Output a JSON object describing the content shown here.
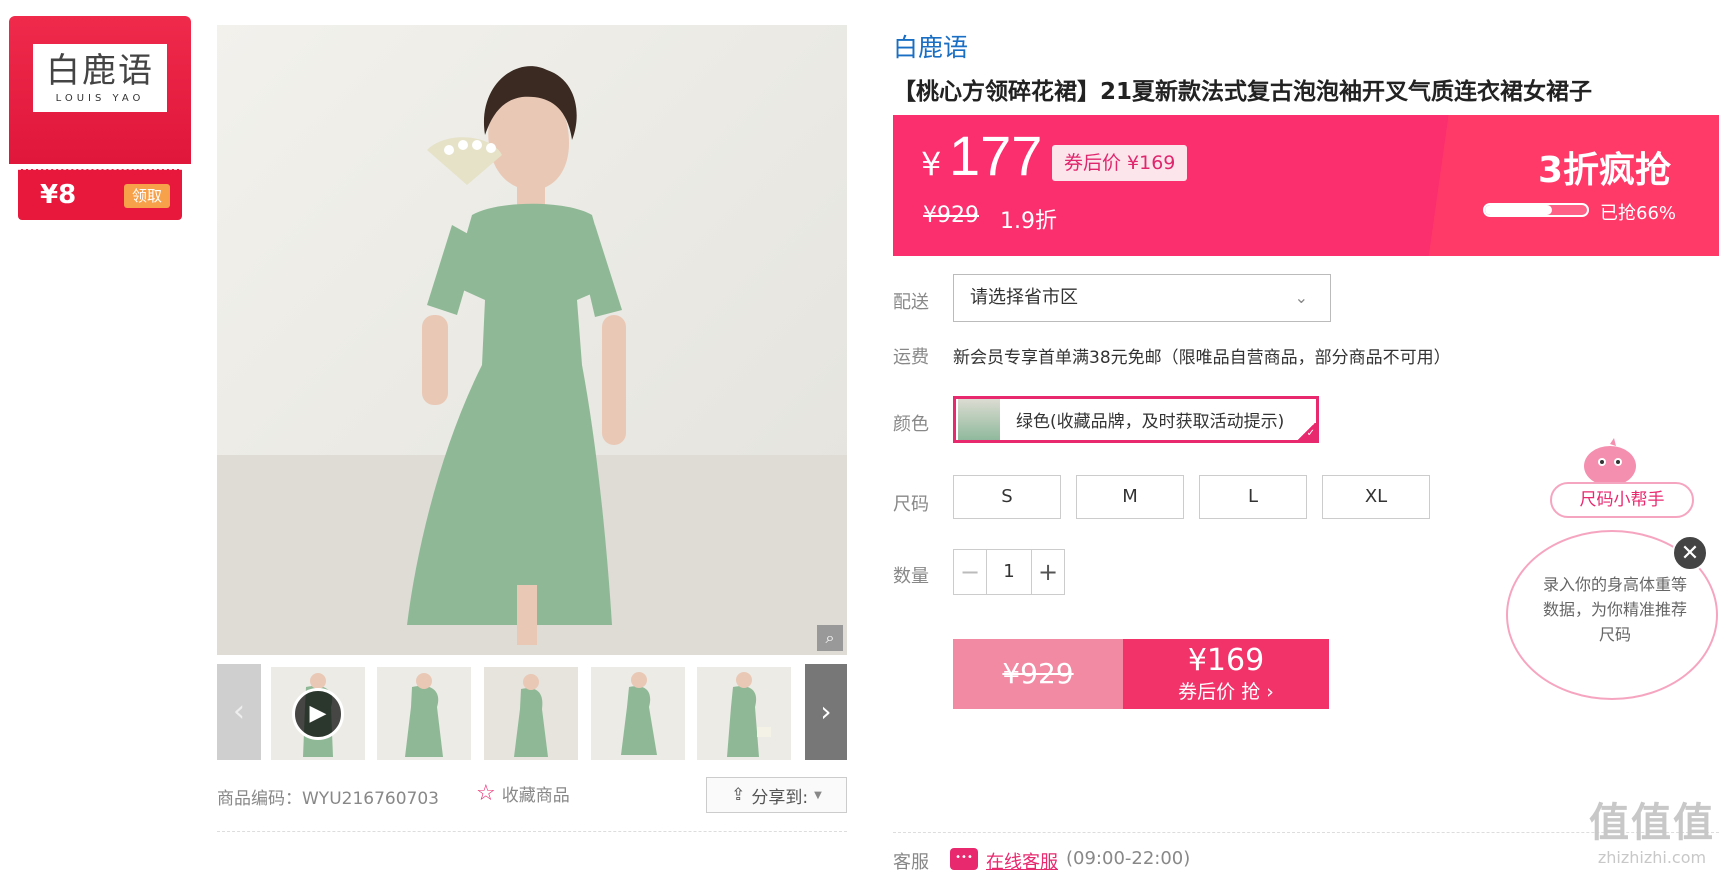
{
  "coupon": {
    "brand_cn": "白鹿语",
    "brand_en": "LOUIS YAO",
    "amount": "¥8",
    "claim_label": "领取"
  },
  "gallery": {
    "product_code": "商品编码：WYU216760703",
    "favorite_label": "收藏商品",
    "share_label": "分享到:"
  },
  "product": {
    "brand": "白鹿语",
    "title": "【桃心方领碎花裙】21夏新款法式复古泡泡袖开叉气质连衣裙女裙子"
  },
  "price": {
    "yen": "¥",
    "current": "177",
    "coupon_tag": "券后价 ¥169",
    "original": "¥929",
    "discount": "1.9折",
    "flash_label": "3折疯抢",
    "sold_progress": 0.66,
    "sold_text": "已抢66%"
  },
  "delivery": {
    "label": "配送",
    "select_value": "请选择省市区"
  },
  "shipping": {
    "label": "运费",
    "text": "新会员专享首单满38元免邮（限唯品自营商品，部分商品不可用）"
  },
  "color": {
    "label": "颜色",
    "option": "绿色(收藏品牌，及时获取活动提示)"
  },
  "size": {
    "label": "尺码",
    "options": [
      "S",
      "M",
      "L",
      "XL"
    ]
  },
  "quantity": {
    "label": "数量",
    "minus": "−",
    "value": "1",
    "plus": "+"
  },
  "buy": {
    "original": "¥929",
    "price": "¥169",
    "sub": "券后价 抢 ›"
  },
  "service": {
    "label": "客服",
    "link": "在线客服",
    "hours": "(09:00-22:00)"
  },
  "helper": {
    "label": "尺码小帮手",
    "text": "录入你的身高体重等数据，为你精准推荐尺码"
  },
  "watermark": {
    "big": "值值值",
    "small": "zhizhizhi.com"
  },
  "colors": {
    "accent": "#fb2e6e",
    "brand_blue": "#1a6fc4",
    "coupon_red": "#e8183d"
  }
}
